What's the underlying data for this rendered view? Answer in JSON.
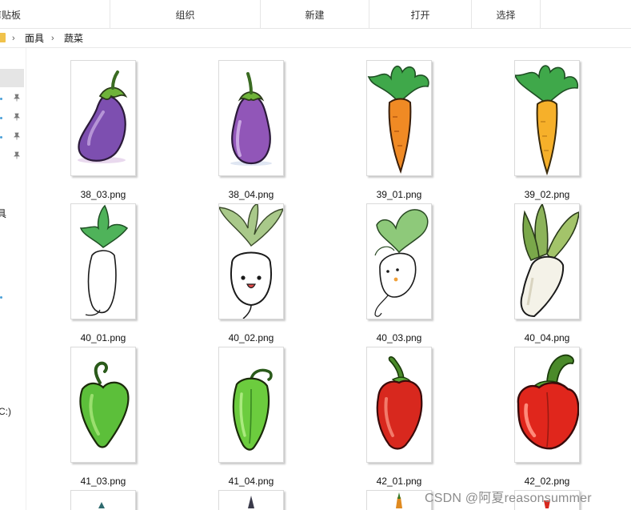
{
  "ribbon": {
    "groups": [
      "剪贴板",
      "组织",
      "新建",
      "打开",
      "选择"
    ]
  },
  "breadcrumb": [
    "面具",
    "蔬菜"
  ],
  "nav": {
    "fragments": [
      "具",
      "C:)"
    ]
  },
  "files": [
    {
      "name": "38_03.png",
      "thumb": "eggplant-a"
    },
    {
      "name": "38_04.png",
      "thumb": "eggplant-b"
    },
    {
      "name": "39_01.png",
      "thumb": "carrot-a"
    },
    {
      "name": "39_02.png",
      "thumb": "carrot-b"
    },
    {
      "name": "40_01.png",
      "thumb": "radish-outline"
    },
    {
      "name": "40_02.png",
      "thumb": "radish-face"
    },
    {
      "name": "40_03.png",
      "thumb": "radish-cute"
    },
    {
      "name": "40_04.png",
      "thumb": "daikon"
    },
    {
      "name": "41_03.png",
      "thumb": "green-pepper-a"
    },
    {
      "name": "41_04.png",
      "thumb": "green-pepper-b"
    },
    {
      "name": "42_01.png",
      "thumb": "red-pepper-a"
    },
    {
      "name": "42_02.png",
      "thumb": "red-pepper-b"
    }
  ],
  "watermark": "CSDN @阿夏reasonsummer",
  "colors": {
    "selection": "#e5e5e5",
    "folder": "#f0c24b",
    "eggplant": "#7d4fb0",
    "carrot": "#f08a24",
    "leaf": "#3fa84a",
    "green_pepper": "#5cbf3a",
    "red_pepper": "#d8281e"
  }
}
